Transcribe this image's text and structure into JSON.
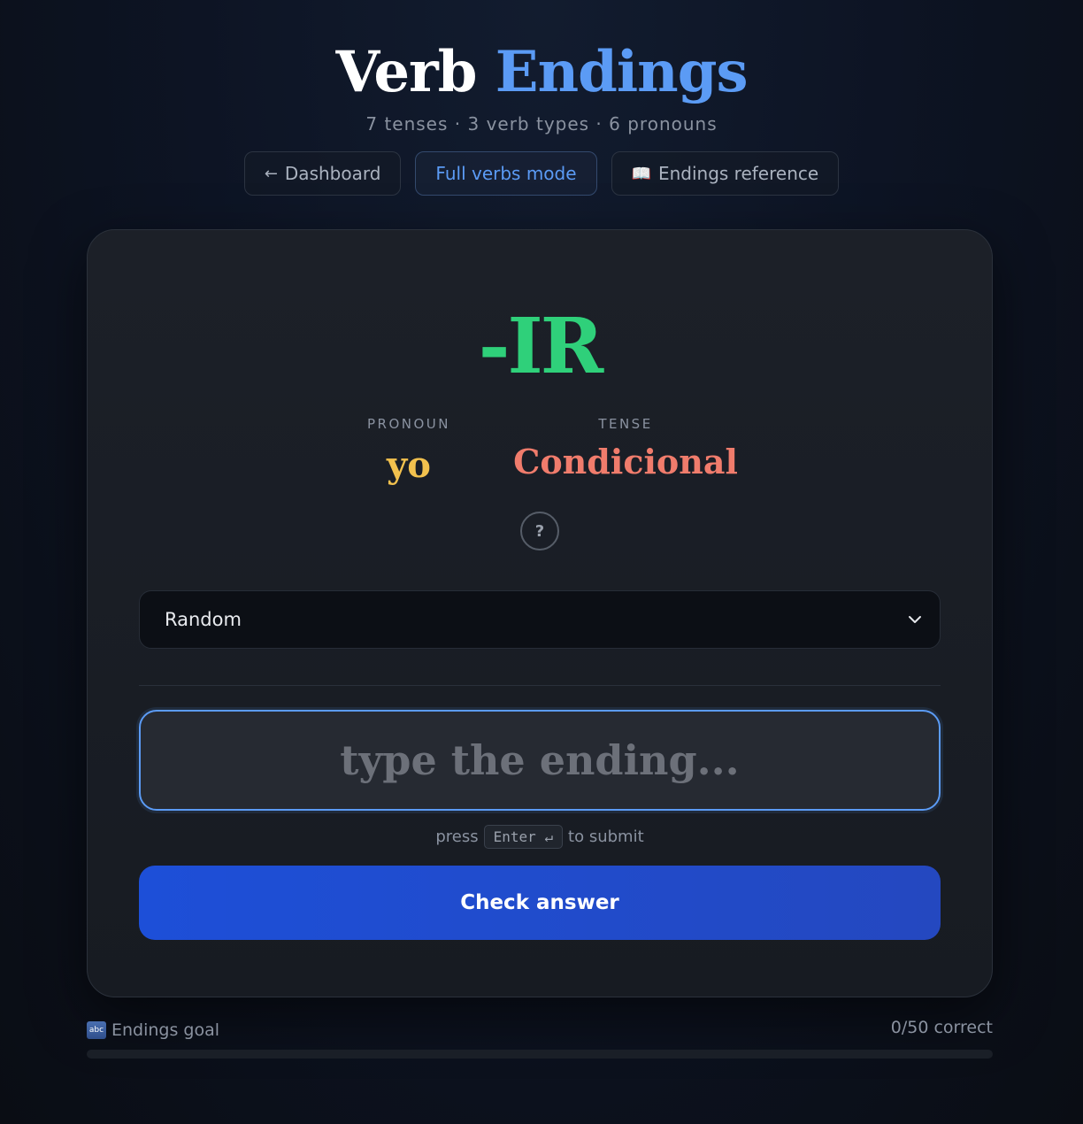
{
  "header": {
    "title_main": "Verb",
    "title_accent": "Endings",
    "subtitle": "7 tenses · 3 verb types · 6 pronouns"
  },
  "nav": {
    "dashboard": "Dashboard",
    "dashboard_icon": "arrow-left-icon",
    "full_verbs": "Full verbs mode",
    "reference": "Endings reference",
    "reference_icon": "book-icon"
  },
  "card": {
    "verb_type": "-IR",
    "pronoun_label": "PRONOUN",
    "pronoun_value": "yo",
    "tense_label": "TENSE",
    "tense_value": "Condicional",
    "help_glyph": "?",
    "select_value": "Random",
    "answer_placeholder": "type the ending...",
    "hint_prefix": "press",
    "hint_key": "Enter ↵",
    "hint_suffix": "to submit",
    "check_button": "Check answer"
  },
  "goal": {
    "label": "Endings goal",
    "icon": "abc-icon",
    "progress_text": "0/50 correct",
    "correct": 0,
    "target": 50
  },
  "colors": {
    "accent": "#5b9bf5",
    "verb_type": "#2fd07a",
    "pronoun": "#f2c14e",
    "tense": "#f07c6c",
    "button": "#1d4fd8"
  }
}
